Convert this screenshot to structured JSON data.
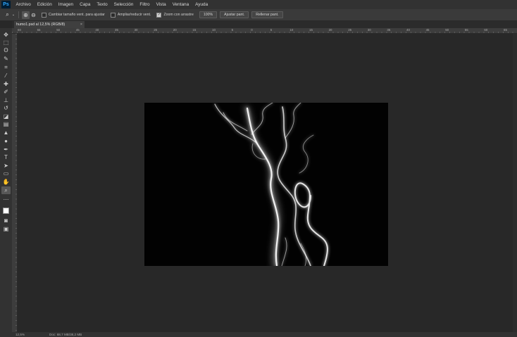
{
  "app": {
    "logo_text": "Ps"
  },
  "menubar": {
    "items": [
      "Archivo",
      "Edición",
      "Imagen",
      "Capa",
      "Texto",
      "Selección",
      "Filtro",
      "Vista",
      "Ventana",
      "Ayuda"
    ]
  },
  "options": {
    "resize_windows_label": "Cambiar tamaño vent. para ajustar",
    "zoom_all_windows_label": "Ampliar/reducir vent.",
    "scrubby_zoom_label": "Zoom con arrastre",
    "resize_windows_checked": false,
    "zoom_all_windows_checked": false,
    "scrubby_zoom_checked": true,
    "zoom_100_button": "100%",
    "fit_screen_button": "Ajustar pant.",
    "fill_screen_button": "Rellenar pant."
  },
  "document": {
    "tab_title": "humo1.psd al 12,5% (RGB/8)",
    "close_glyph": "×"
  },
  "ruler": {
    "top_ticks": [
      "60",
      "55",
      "50",
      "45",
      "40",
      "35",
      "30",
      "25",
      "20",
      "15",
      "10",
      "5",
      "0",
      "5",
      "10",
      "15",
      "20",
      "25",
      "30",
      "35",
      "40",
      "45",
      "50",
      "55",
      "60",
      "65"
    ]
  },
  "status": {
    "zoom": "12,5%",
    "doc_size": "Doc: 68,7 MB/38,2 MB"
  },
  "tools": [
    {
      "name": "move-tool-icon",
      "glyph": "✥"
    },
    {
      "name": "marquee-tool-icon",
      "glyph": "⬚"
    },
    {
      "name": "lasso-tool-icon",
      "glyph": "ʘ"
    },
    {
      "name": "quick-selection-tool-icon",
      "glyph": "✎"
    },
    {
      "name": "crop-tool-icon",
      "glyph": "⌗"
    },
    {
      "name": "eyedropper-tool-icon",
      "glyph": "⁄"
    },
    {
      "name": "healing-brush-tool-icon",
      "glyph": "✚"
    },
    {
      "name": "brush-tool-icon",
      "glyph": "✐"
    },
    {
      "name": "clone-stamp-tool-icon",
      "glyph": "⊥"
    },
    {
      "name": "history-brush-tool-icon",
      "glyph": "↺"
    },
    {
      "name": "eraser-tool-icon",
      "glyph": "◪"
    },
    {
      "name": "gradient-tool-icon",
      "glyph": "▤"
    },
    {
      "name": "blur-tool-icon",
      "glyph": "▲"
    },
    {
      "name": "dodge-tool-icon",
      "glyph": "●"
    },
    {
      "name": "pen-tool-icon",
      "glyph": "✒"
    },
    {
      "name": "type-tool-icon",
      "glyph": "T"
    },
    {
      "name": "path-selection-tool-icon",
      "glyph": "➤"
    },
    {
      "name": "shape-tool-icon",
      "glyph": "▭"
    },
    {
      "name": "hand-tool-icon",
      "glyph": "✋"
    },
    {
      "name": "zoom-tool-icon",
      "glyph": "⌕"
    },
    {
      "name": "more-tools-icon",
      "glyph": "⋯"
    },
    {
      "name": "color-swatches-icon",
      "glyph": ""
    },
    {
      "name": "quick-mask-icon",
      "glyph": "◙"
    },
    {
      "name": "screen-mode-icon",
      "glyph": "▣"
    }
  ]
}
